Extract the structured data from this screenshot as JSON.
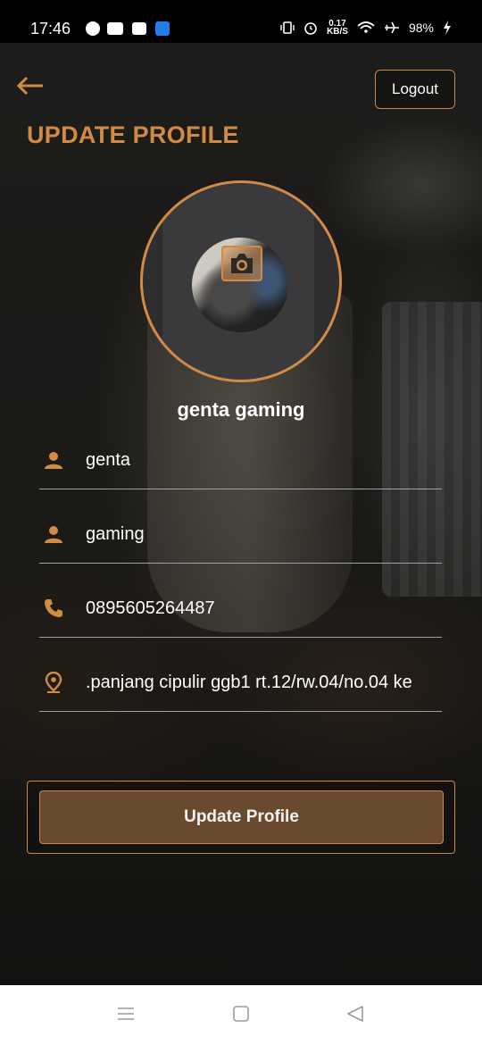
{
  "status_bar": {
    "time": "17:46",
    "apps": [
      "facebook-icon",
      "lazada-icon",
      "ge-icon",
      "usb-icon"
    ],
    "speed_value": "0.17",
    "speed_unit": "KB/S",
    "battery": "98%"
  },
  "header": {
    "back_icon": "arrow-left-icon",
    "logout_label": "Logout",
    "title": "UPDATE PROFILE"
  },
  "profile": {
    "avatar_icon": "camera-icon",
    "display_name": "genta gaming"
  },
  "form": {
    "first_name": {
      "icon": "person-icon",
      "value": "genta"
    },
    "last_name": {
      "icon": "person-icon",
      "value": "gaming"
    },
    "phone": {
      "icon": "phone-icon",
      "value": "0895605264487"
    },
    "address": {
      "icon": "location-pin-icon",
      "value": ".panjang cipulir ggb1 rt.12/rw.04/no.04 ke"
    }
  },
  "actions": {
    "update_label": "Update Profile"
  },
  "colors": {
    "accent": "#d28a47",
    "button_fill": "#6a4a2e",
    "divider": "#9aa3ab"
  },
  "navigation": [
    "menu-icon",
    "home-square-icon",
    "back-triangle-icon"
  ]
}
